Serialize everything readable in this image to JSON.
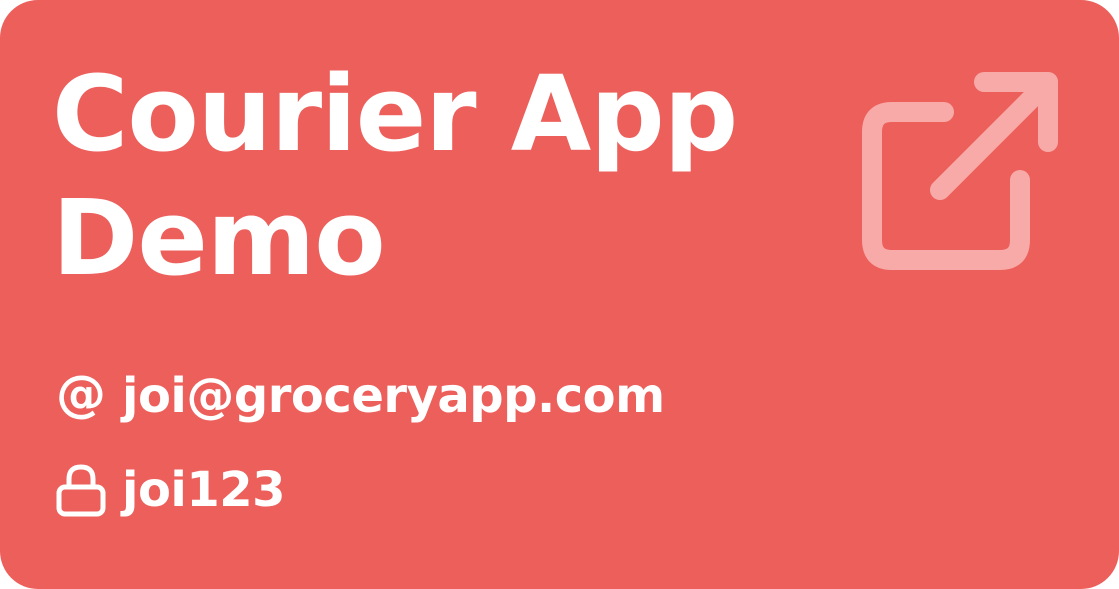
{
  "card": {
    "title_line1": "Courier App",
    "title_line2": "Demo",
    "email": "joi@groceryapp.com",
    "password": "joi123",
    "icons": {
      "email": "at-icon",
      "password": "lock-icon",
      "link": "external-link-icon"
    },
    "colors": {
      "background": "#ec5f5b",
      "text": "#ffffff",
      "link_icon": "#f7aaa8"
    }
  }
}
